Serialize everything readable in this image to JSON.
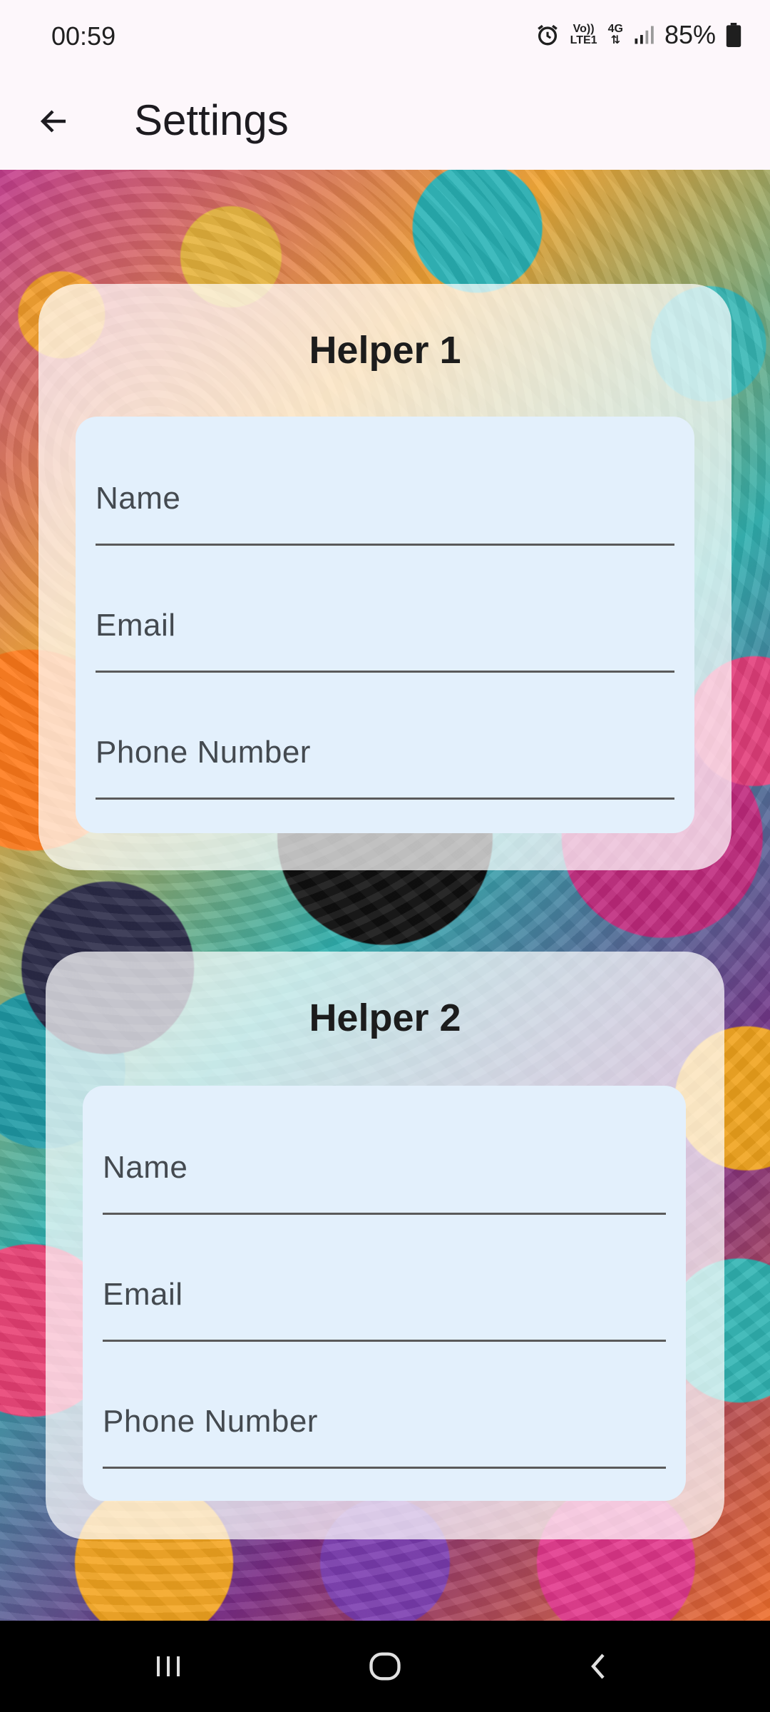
{
  "status_bar": {
    "time": "00:59",
    "battery": "85%",
    "network_top": "Vo)) LTE1",
    "network_type": "4G",
    "icons": [
      "alarm-icon",
      "volte-icon",
      "4g-icon",
      "signal-icon",
      "battery-icon"
    ]
  },
  "app_bar": {
    "title": "Settings",
    "back_icon": "arrow-left-icon"
  },
  "helpers": [
    {
      "title": "Helper 1",
      "fields": [
        {
          "label": "Name",
          "value": ""
        },
        {
          "label": "Email",
          "value": ""
        },
        {
          "label": "Phone Number",
          "value": ""
        }
      ]
    },
    {
      "title": "Helper 2",
      "fields": [
        {
          "label": "Name",
          "value": ""
        },
        {
          "label": "Email",
          "value": ""
        },
        {
          "label": "Phone Number",
          "value": ""
        }
      ]
    }
  ],
  "nav_bar": {
    "icons": [
      "recent-apps-icon",
      "home-icon",
      "back-nav-icon"
    ]
  },
  "colors": {
    "app_bar_bg": "#fdf7fb",
    "card_bg": "rgba(255,255,255,0.72)",
    "form_bg": "#e3f0fc"
  }
}
